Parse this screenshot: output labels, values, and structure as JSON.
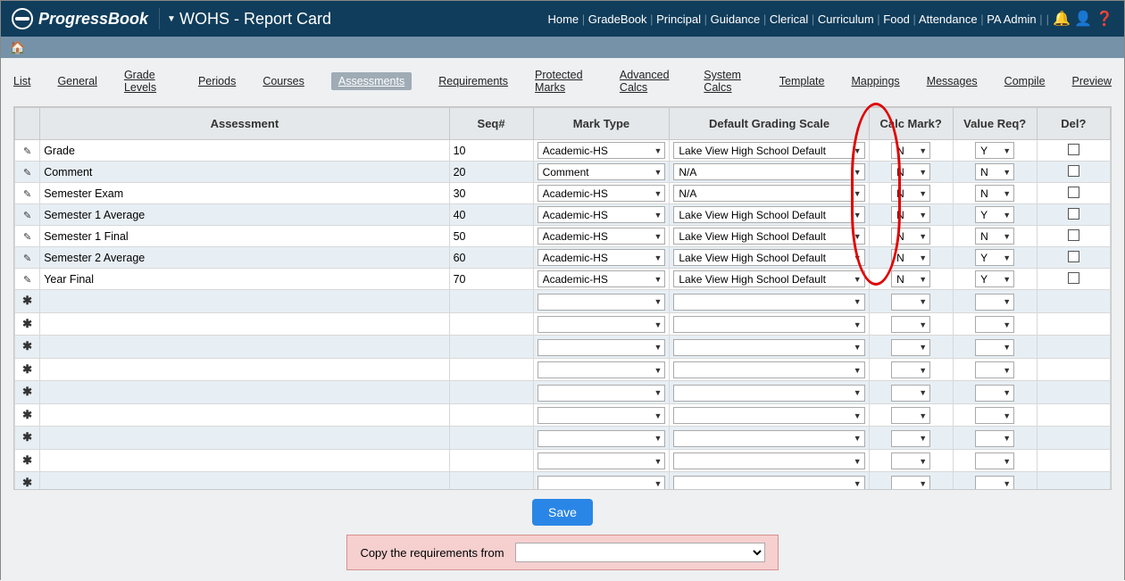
{
  "brand": "ProgressBook",
  "context": "WOHS - Report Card",
  "topnav": [
    "Home",
    "GradeBook",
    "Principal",
    "Guidance",
    "Clerical",
    "Curriculum",
    "Food",
    "Attendance",
    "PA Admin"
  ],
  "tabs": {
    "items": [
      "List",
      "General",
      "Grade Levels",
      "Periods",
      "Courses",
      "Assessments",
      "Requirements",
      "Protected Marks",
      "Advanced Calcs",
      "System Calcs",
      "Template",
      "Mappings",
      "Messages",
      "Compile",
      "Preview"
    ],
    "active_index": 5
  },
  "headers": {
    "assessment": "Assessment",
    "seq": "Seq#",
    "mark_type": "Mark Type",
    "dgs": "Default Grading Scale",
    "calc_mark": "Calc Mark?",
    "value_req": "Value Req?",
    "del": "Del?"
  },
  "rows": [
    {
      "name": "Grade",
      "seq": "10",
      "mark_type": "Academic-HS",
      "dgs": "Lake View High School Default",
      "calc": "N",
      "vreq": "Y"
    },
    {
      "name": "Comment",
      "seq": "20",
      "mark_type": "Comment",
      "dgs": "N/A",
      "calc": "N",
      "vreq": "N"
    },
    {
      "name": "Semester Exam",
      "seq": "30",
      "mark_type": "Academic-HS",
      "dgs": "N/A",
      "calc": "N",
      "vreq": "N"
    },
    {
      "name": "Semester 1 Average",
      "seq": "40",
      "mark_type": "Academic-HS",
      "dgs": "Lake View High School Default",
      "calc": "N",
      "vreq": "Y"
    },
    {
      "name": "Semester 1 Final",
      "seq": "50",
      "mark_type": "Academic-HS",
      "dgs": "Lake View High School Default",
      "calc": "N",
      "vreq": "N"
    },
    {
      "name": "Semester 2 Average",
      "seq": "60",
      "mark_type": "Academic-HS",
      "dgs": "Lake View High School Default",
      "calc": "N",
      "vreq": "Y"
    },
    {
      "name": "Year Final",
      "seq": "70",
      "mark_type": "Academic-HS",
      "dgs": "Lake View High School Default",
      "calc": "N",
      "vreq": "Y"
    }
  ],
  "empty_row_count": 11,
  "save_label": "Save",
  "copy_label": "Copy the requirements from"
}
